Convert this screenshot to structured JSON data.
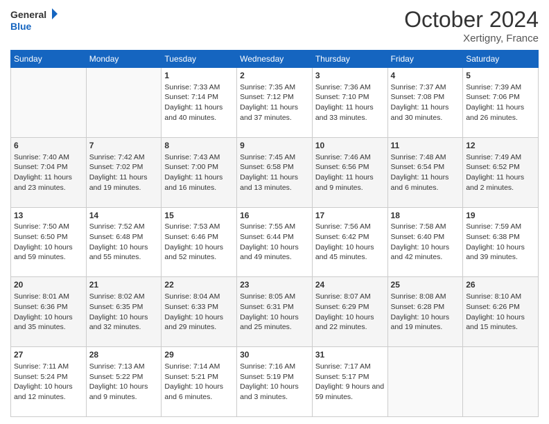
{
  "header": {
    "logo_line1": "General",
    "logo_line2": "Blue",
    "month": "October 2024",
    "location": "Xertigny, France"
  },
  "weekdays": [
    "Sunday",
    "Monday",
    "Tuesday",
    "Wednesday",
    "Thursday",
    "Friday",
    "Saturday"
  ],
  "rows": [
    [
      {
        "day": "",
        "sunrise": "",
        "sunset": "",
        "daylight": ""
      },
      {
        "day": "",
        "sunrise": "",
        "sunset": "",
        "daylight": ""
      },
      {
        "day": "1",
        "sunrise": "Sunrise: 7:33 AM",
        "sunset": "Sunset: 7:14 PM",
        "daylight": "Daylight: 11 hours and 40 minutes."
      },
      {
        "day": "2",
        "sunrise": "Sunrise: 7:35 AM",
        "sunset": "Sunset: 7:12 PM",
        "daylight": "Daylight: 11 hours and 37 minutes."
      },
      {
        "day": "3",
        "sunrise": "Sunrise: 7:36 AM",
        "sunset": "Sunset: 7:10 PM",
        "daylight": "Daylight: 11 hours and 33 minutes."
      },
      {
        "day": "4",
        "sunrise": "Sunrise: 7:37 AM",
        "sunset": "Sunset: 7:08 PM",
        "daylight": "Daylight: 11 hours and 30 minutes."
      },
      {
        "day": "5",
        "sunrise": "Sunrise: 7:39 AM",
        "sunset": "Sunset: 7:06 PM",
        "daylight": "Daylight: 11 hours and 26 minutes."
      }
    ],
    [
      {
        "day": "6",
        "sunrise": "Sunrise: 7:40 AM",
        "sunset": "Sunset: 7:04 PM",
        "daylight": "Daylight: 11 hours and 23 minutes."
      },
      {
        "day": "7",
        "sunrise": "Sunrise: 7:42 AM",
        "sunset": "Sunset: 7:02 PM",
        "daylight": "Daylight: 11 hours and 19 minutes."
      },
      {
        "day": "8",
        "sunrise": "Sunrise: 7:43 AM",
        "sunset": "Sunset: 7:00 PM",
        "daylight": "Daylight: 11 hours and 16 minutes."
      },
      {
        "day": "9",
        "sunrise": "Sunrise: 7:45 AM",
        "sunset": "Sunset: 6:58 PM",
        "daylight": "Daylight: 11 hours and 13 minutes."
      },
      {
        "day": "10",
        "sunrise": "Sunrise: 7:46 AM",
        "sunset": "Sunset: 6:56 PM",
        "daylight": "Daylight: 11 hours and 9 minutes."
      },
      {
        "day": "11",
        "sunrise": "Sunrise: 7:48 AM",
        "sunset": "Sunset: 6:54 PM",
        "daylight": "Daylight: 11 hours and 6 minutes."
      },
      {
        "day": "12",
        "sunrise": "Sunrise: 7:49 AM",
        "sunset": "Sunset: 6:52 PM",
        "daylight": "Daylight: 11 hours and 2 minutes."
      }
    ],
    [
      {
        "day": "13",
        "sunrise": "Sunrise: 7:50 AM",
        "sunset": "Sunset: 6:50 PM",
        "daylight": "Daylight: 10 hours and 59 minutes."
      },
      {
        "day": "14",
        "sunrise": "Sunrise: 7:52 AM",
        "sunset": "Sunset: 6:48 PM",
        "daylight": "Daylight: 10 hours and 55 minutes."
      },
      {
        "day": "15",
        "sunrise": "Sunrise: 7:53 AM",
        "sunset": "Sunset: 6:46 PM",
        "daylight": "Daylight: 10 hours and 52 minutes."
      },
      {
        "day": "16",
        "sunrise": "Sunrise: 7:55 AM",
        "sunset": "Sunset: 6:44 PM",
        "daylight": "Daylight: 10 hours and 49 minutes."
      },
      {
        "day": "17",
        "sunrise": "Sunrise: 7:56 AM",
        "sunset": "Sunset: 6:42 PM",
        "daylight": "Daylight: 10 hours and 45 minutes."
      },
      {
        "day": "18",
        "sunrise": "Sunrise: 7:58 AM",
        "sunset": "Sunset: 6:40 PM",
        "daylight": "Daylight: 10 hours and 42 minutes."
      },
      {
        "day": "19",
        "sunrise": "Sunrise: 7:59 AM",
        "sunset": "Sunset: 6:38 PM",
        "daylight": "Daylight: 10 hours and 39 minutes."
      }
    ],
    [
      {
        "day": "20",
        "sunrise": "Sunrise: 8:01 AM",
        "sunset": "Sunset: 6:36 PM",
        "daylight": "Daylight: 10 hours and 35 minutes."
      },
      {
        "day": "21",
        "sunrise": "Sunrise: 8:02 AM",
        "sunset": "Sunset: 6:35 PM",
        "daylight": "Daylight: 10 hours and 32 minutes."
      },
      {
        "day": "22",
        "sunrise": "Sunrise: 8:04 AM",
        "sunset": "Sunset: 6:33 PM",
        "daylight": "Daylight: 10 hours and 29 minutes."
      },
      {
        "day": "23",
        "sunrise": "Sunrise: 8:05 AM",
        "sunset": "Sunset: 6:31 PM",
        "daylight": "Daylight: 10 hours and 25 minutes."
      },
      {
        "day": "24",
        "sunrise": "Sunrise: 8:07 AM",
        "sunset": "Sunset: 6:29 PM",
        "daylight": "Daylight: 10 hours and 22 minutes."
      },
      {
        "day": "25",
        "sunrise": "Sunrise: 8:08 AM",
        "sunset": "Sunset: 6:28 PM",
        "daylight": "Daylight: 10 hours and 19 minutes."
      },
      {
        "day": "26",
        "sunrise": "Sunrise: 8:10 AM",
        "sunset": "Sunset: 6:26 PM",
        "daylight": "Daylight: 10 hours and 15 minutes."
      }
    ],
    [
      {
        "day": "27",
        "sunrise": "Sunrise: 7:11 AM",
        "sunset": "Sunset: 5:24 PM",
        "daylight": "Daylight: 10 hours and 12 minutes."
      },
      {
        "day": "28",
        "sunrise": "Sunrise: 7:13 AM",
        "sunset": "Sunset: 5:22 PM",
        "daylight": "Daylight: 10 hours and 9 minutes."
      },
      {
        "day": "29",
        "sunrise": "Sunrise: 7:14 AM",
        "sunset": "Sunset: 5:21 PM",
        "daylight": "Daylight: 10 hours and 6 minutes."
      },
      {
        "day": "30",
        "sunrise": "Sunrise: 7:16 AM",
        "sunset": "Sunset: 5:19 PM",
        "daylight": "Daylight: 10 hours and 3 minutes."
      },
      {
        "day": "31",
        "sunrise": "Sunrise: 7:17 AM",
        "sunset": "Sunset: 5:17 PM",
        "daylight": "Daylight: 9 hours and 59 minutes."
      },
      {
        "day": "",
        "sunrise": "",
        "sunset": "",
        "daylight": ""
      },
      {
        "day": "",
        "sunrise": "",
        "sunset": "",
        "daylight": ""
      }
    ]
  ]
}
